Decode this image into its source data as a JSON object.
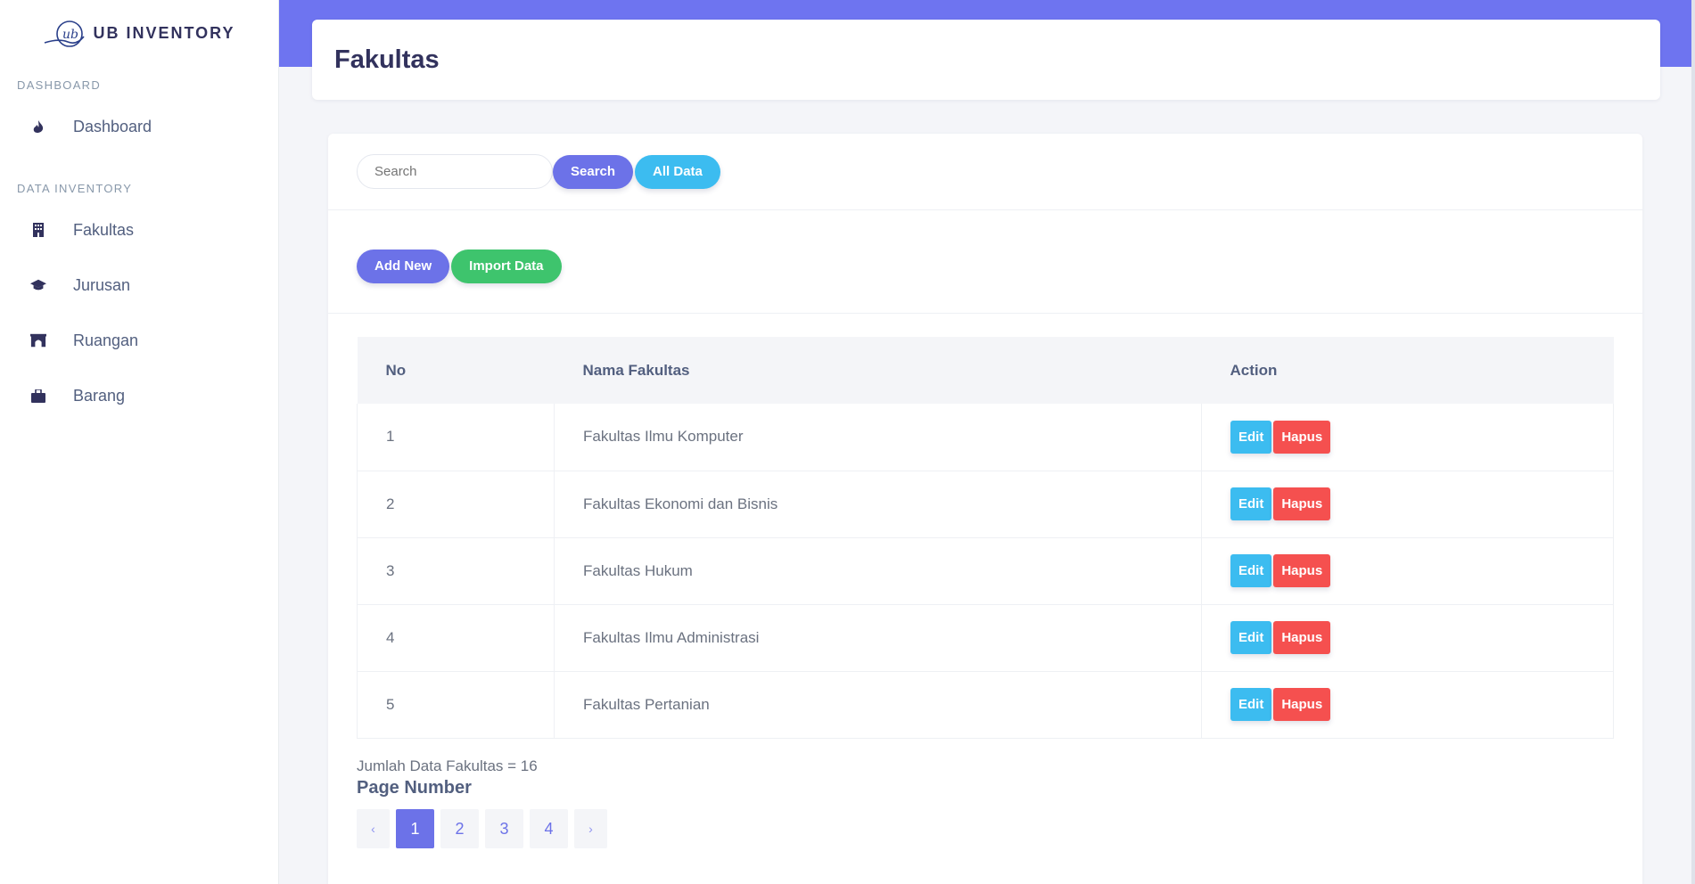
{
  "brand": {
    "name": "UB INVENTORY",
    "logo_text": "ub"
  },
  "sidebar": {
    "sections": [
      {
        "heading": "DASHBOARD",
        "items": [
          {
            "label": "Dashboard",
            "icon": "fire-icon"
          }
        ]
      },
      {
        "heading": "DATA INVENTORY",
        "items": [
          {
            "label": "Fakultas",
            "icon": "building-icon"
          },
          {
            "label": "Jurusan",
            "icon": "graduation-cap-icon"
          },
          {
            "label": "Ruangan",
            "icon": "archway-icon"
          },
          {
            "label": "Barang",
            "icon": "briefcase-icon"
          }
        ]
      }
    ]
  },
  "header": {
    "title": "Fakultas"
  },
  "search": {
    "placeholder": "Search",
    "search_label": "Search",
    "all_label": "All Data"
  },
  "actions": {
    "add_label": "Add New",
    "import_label": "Import Data"
  },
  "table": {
    "columns": [
      "No",
      "Nama Fakultas",
      "Action"
    ],
    "rows": [
      {
        "no": "1",
        "name": "Fakultas Ilmu Komputer"
      },
      {
        "no": "2",
        "name": "Fakultas Ekonomi dan Bisnis"
      },
      {
        "no": "3",
        "name": "Fakultas Hukum"
      },
      {
        "no": "4",
        "name": "Fakultas Ilmu Administrasi"
      },
      {
        "no": "5",
        "name": "Fakultas Pertanian"
      }
    ],
    "edit_label": "Edit",
    "delete_label": "Hapus"
  },
  "summary": {
    "total_text": "Jumlah Data Fakultas = 16",
    "page_label": "Page Number"
  },
  "pagination": {
    "prev": "‹",
    "next": "›",
    "pages": [
      "1",
      "2",
      "3",
      "4"
    ],
    "active_page": "1"
  },
  "colors": {
    "primary": "#6c72e8",
    "info": "#3cbcf0",
    "success": "#3ec46d",
    "danger": "#f5504f"
  }
}
